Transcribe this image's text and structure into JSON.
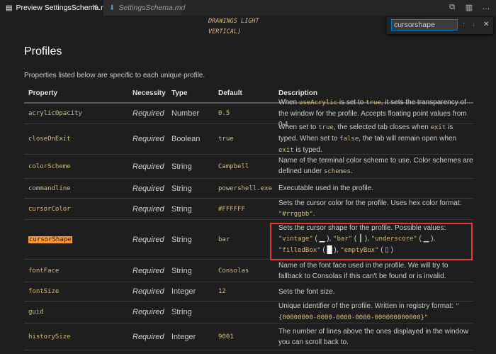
{
  "tabs": [
    {
      "label": "Preview SettingsSchema.md",
      "icon": "preview-icon"
    },
    {
      "label": "SettingsSchema.md",
      "icon": "markdown-icon"
    }
  ],
  "find": {
    "value": "cursorshape"
  },
  "fragment": {
    "line1": "DRAWINGS LIGHT",
    "line2": "VERTICAL)"
  },
  "section": {
    "title": "Profiles",
    "intro": "Properties listed below are specific to each unique profile."
  },
  "table": {
    "headers": [
      "Property",
      "Necessity",
      "Type",
      "Default",
      "Description"
    ],
    "rows": [
      {
        "property": "acrylicOpacity",
        "necessity": "Required",
        "type": "Number",
        "default": "0.5",
        "desc": [
          {
            "t": "When "
          },
          {
            "c": "useAcrylic"
          },
          {
            "t": " is set to "
          },
          {
            "c": "true"
          },
          {
            "t": ", it sets the transparency of the window for the profile. Accepts floating point values from 0-1."
          }
        ]
      },
      {
        "property": "closeOnExit",
        "necessity": "Required",
        "type": "Boolean",
        "default": "true",
        "desc": [
          {
            "t": "When set to "
          },
          {
            "c": "true"
          },
          {
            "t": ", the selected tab closes when "
          },
          {
            "c": "exit"
          },
          {
            "t": " is typed. When set to "
          },
          {
            "c": "false"
          },
          {
            "t": ", the tab will remain open when "
          },
          {
            "c": "exit"
          },
          {
            "t": " is typed."
          }
        ]
      },
      {
        "property": "colorScheme",
        "necessity": "Required",
        "type": "String",
        "default": "Campbell",
        "desc": [
          {
            "t": "Name of the terminal color scheme to use. Color schemes are defined under "
          },
          {
            "c": "schemes"
          },
          {
            "t": "."
          }
        ]
      },
      {
        "property": "commandline",
        "necessity": "Required",
        "type": "String",
        "default": "powershell.exe",
        "desc": [
          {
            "t": "Executable used in the profile."
          }
        ]
      },
      {
        "property": "cursorColor",
        "necessity": "Required",
        "type": "String",
        "default": "#FFFFFF",
        "desc": [
          {
            "t": "Sets the cursor color for the profile. Uses hex color format: "
          },
          {
            "c": "\"#rrggbb\""
          },
          {
            "t": "."
          }
        ]
      },
      {
        "property": "cursorShape",
        "necessity": "Required",
        "type": "String",
        "default": "bar",
        "desc": [
          {
            "t": "Sets the cursor shape for the profile. Possible values: "
          },
          {
            "c": "\"vintage\""
          },
          {
            "t": " ( "
          },
          {
            "g": "▁"
          },
          {
            "t": " ), "
          },
          {
            "c": "\"bar\""
          },
          {
            "t": " ( ┃ ), "
          },
          {
            "c": "\"underscore\""
          },
          {
            "t": " ( ▁ ), "
          },
          {
            "c": "\"filledBox\""
          },
          {
            "t": " ( "
          },
          {
            "g": "█"
          },
          {
            "t": " ), "
          },
          {
            "c": "\"emptyBox\""
          },
          {
            "t": " ( ▯ )"
          }
        ]
      },
      {
        "property": "fontFace",
        "necessity": "Required",
        "type": "String",
        "default": "Consolas",
        "desc": [
          {
            "t": "Name of the font face used in the profile. We will try to fallback to Consolas if this can't be found or is invalid."
          }
        ]
      },
      {
        "property": "fontSize",
        "necessity": "Required",
        "type": "Integer",
        "default": "12",
        "desc": [
          {
            "t": "Sets the font size."
          }
        ]
      },
      {
        "property": "guid",
        "necessity": "Required",
        "type": "String",
        "default": "",
        "desc": [
          {
            "t": "Unique identifier of the profile. Written in registry format: "
          },
          {
            "c": "\"{00000000-0000-0000-0000-000000000000}\""
          }
        ]
      },
      {
        "property": "historySize",
        "necessity": "Required",
        "type": "Integer",
        "default": "9001",
        "desc": [
          {
            "t": "The number of lines above the ones displayed in the window you can scroll back to."
          }
        ]
      }
    ]
  },
  "highlight": {
    "term": "cursorShape"
  }
}
